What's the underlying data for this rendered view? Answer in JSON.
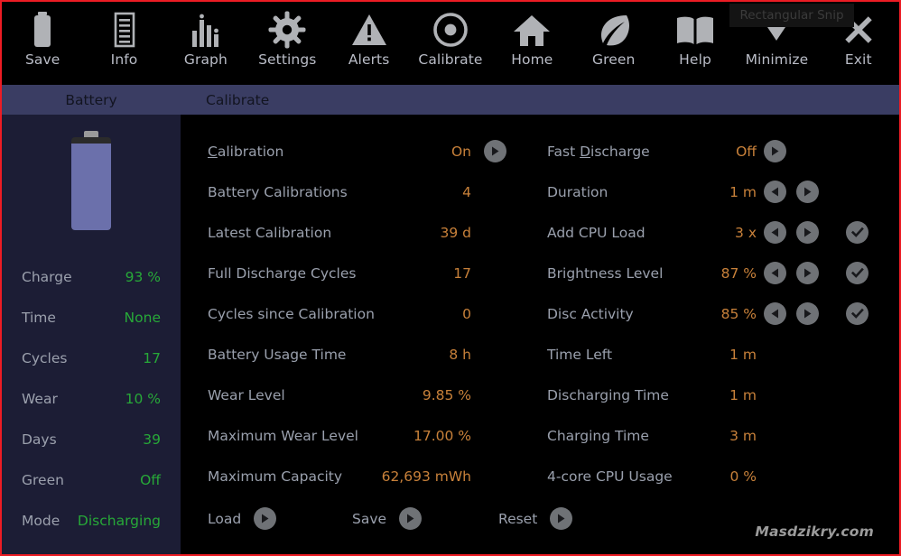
{
  "window": {
    "snip_tooltip": "Rectangular Snip",
    "watermark": "Masdzikry.com"
  },
  "toolbar": {
    "items": [
      {
        "label": "Save",
        "icon": "battery-icon"
      },
      {
        "label": "Info",
        "icon": "document-lines-icon"
      },
      {
        "label": "Graph",
        "icon": "bar-chart-icon"
      },
      {
        "label": "Settings",
        "icon": "gear-icon"
      },
      {
        "label": "Alerts",
        "icon": "warning-triangle-icon"
      },
      {
        "label": "Calibrate",
        "icon": "target-circle-icon"
      },
      {
        "label": "Home",
        "icon": "home-icon"
      },
      {
        "label": "Green",
        "icon": "leaf-icon"
      },
      {
        "label": "Help",
        "icon": "book-icon"
      },
      {
        "label": "Minimize",
        "icon": "minimize-icon"
      },
      {
        "label": "Exit",
        "icon": "close-x-icon"
      }
    ]
  },
  "tabs": [
    {
      "label": "Battery",
      "active": true
    },
    {
      "label": "Calibrate",
      "active": false
    }
  ],
  "sidebar": {
    "battery": {
      "charge_percent": 93
    },
    "rows": [
      {
        "label": "Charge",
        "value": "93 %"
      },
      {
        "label": "Time",
        "value": "None"
      },
      {
        "label": "Cycles",
        "value": "17"
      },
      {
        "label": "Wear",
        "value": "10 %"
      },
      {
        "label": "Days",
        "value": "39"
      },
      {
        "label": "Green",
        "value": "Off"
      },
      {
        "label": "Mode",
        "value": "Discharging"
      }
    ]
  },
  "main": {
    "left_column": [
      {
        "label": "Calibration",
        "accel": "C",
        "value": "On",
        "controls": [
          "play"
        ]
      },
      {
        "label": "Battery Calibrations",
        "value": "4",
        "controls": []
      },
      {
        "label": "Latest Calibration",
        "value": "39 d",
        "controls": []
      },
      {
        "label": "Full Discharge Cycles",
        "value": "17",
        "controls": []
      },
      {
        "label": "Cycles since Calibration",
        "value": "0",
        "controls": []
      },
      {
        "label": "Battery Usage Time",
        "value": "8 h",
        "controls": []
      },
      {
        "label": "Wear Level",
        "value": "9.85 %",
        "controls": []
      },
      {
        "label": "Maximum Wear Level",
        "value": "17.00 %",
        "controls": []
      },
      {
        "label": "Maximum Capacity",
        "value": "62,693 mWh",
        "controls": []
      }
    ],
    "right_column": [
      {
        "label": "Fast Discharge",
        "accel": "D",
        "value": "Off",
        "controls": [
          "play"
        ]
      },
      {
        "label": "Duration",
        "value": "1 m",
        "controls": [
          "prev",
          "next"
        ]
      },
      {
        "label": "Add CPU Load",
        "value": "3 x",
        "controls": [
          "prev",
          "next",
          "check"
        ]
      },
      {
        "label": "Brightness Level",
        "value": "87 %",
        "controls": [
          "prev",
          "next",
          "check"
        ]
      },
      {
        "label": "Disc Activity",
        "value": "85 %",
        "controls": [
          "prev",
          "next",
          "check"
        ]
      },
      {
        "label": "Time Left",
        "value": "1 m",
        "controls": []
      },
      {
        "label": "Discharging Time",
        "value": "1 m",
        "controls": []
      },
      {
        "label": "Charging Time",
        "value": "3 m",
        "controls": []
      },
      {
        "label": "4-core CPU Usage",
        "value": "0 %",
        "controls": []
      }
    ],
    "actions": [
      {
        "label": "Load",
        "icon": "play-icon"
      },
      {
        "label": "Save",
        "icon": "play-icon"
      },
      {
        "label": "Reset",
        "icon": "play-icon"
      }
    ]
  },
  "colors": {
    "value_orange": "#c8813a",
    "value_green": "#27a838",
    "label_gray": "#9aa0ad",
    "tabbar_blue": "#3a3d63",
    "sidebar_navy": "#1c1d35",
    "battery_fill": "#6b70ab",
    "selection_border_red": "#ec1c24"
  }
}
